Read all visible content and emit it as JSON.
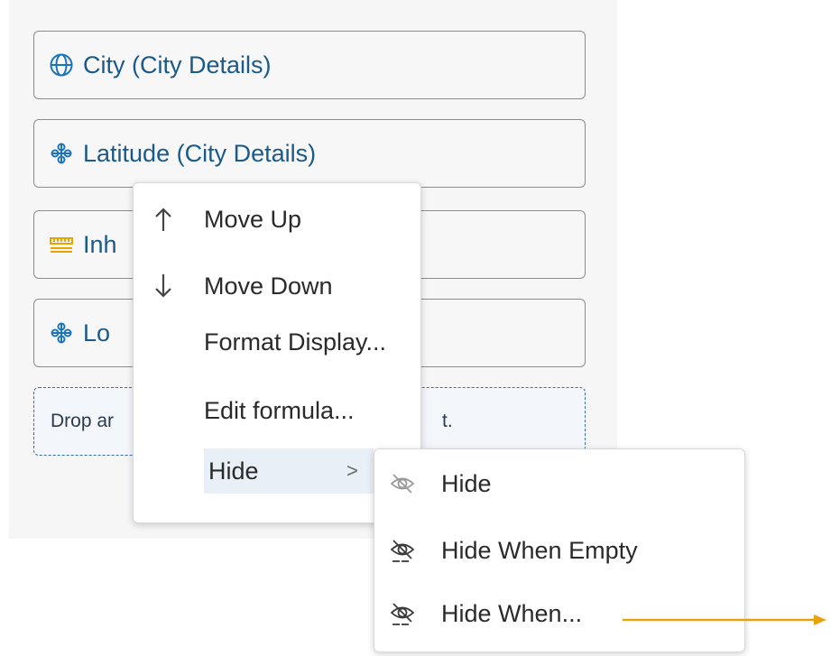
{
  "fields": [
    {
      "label": "City (City Details)",
      "icon": "globe-icon"
    },
    {
      "label": "Latitude (City Details)",
      "icon": "dimension-icon"
    },
    {
      "label": "Inh",
      "icon": "measure-icon"
    },
    {
      "label": "Lo",
      "icon": "dimension-icon"
    }
  ],
  "drop_zone": {
    "text_left": "Drop ar",
    "text_right": "t."
  },
  "context_menu": {
    "items": [
      {
        "label": "Move Up",
        "icon": "arrow-up-icon"
      },
      {
        "label": "Move Down",
        "icon": "arrow-down-icon"
      },
      {
        "label": "Format Display..."
      },
      {
        "label": "Edit formula..."
      },
      {
        "label": "Hide",
        "submenu_indicator": ">"
      }
    ]
  },
  "hide_submenu": {
    "items": [
      {
        "label": "Hide",
        "icon": "hide-icon"
      },
      {
        "label": "Hide When Empty",
        "icon": "hide-when-icon"
      },
      {
        "label": "Hide When...",
        "icon": "hide-when-icon"
      }
    ]
  },
  "colors": {
    "field_text": "#1a5a8a",
    "accent_icon": "#1e74b8",
    "measure_icon": "#e9a400",
    "callout_arrow": "#e8a20b",
    "highlight": "#e8eff7"
  }
}
